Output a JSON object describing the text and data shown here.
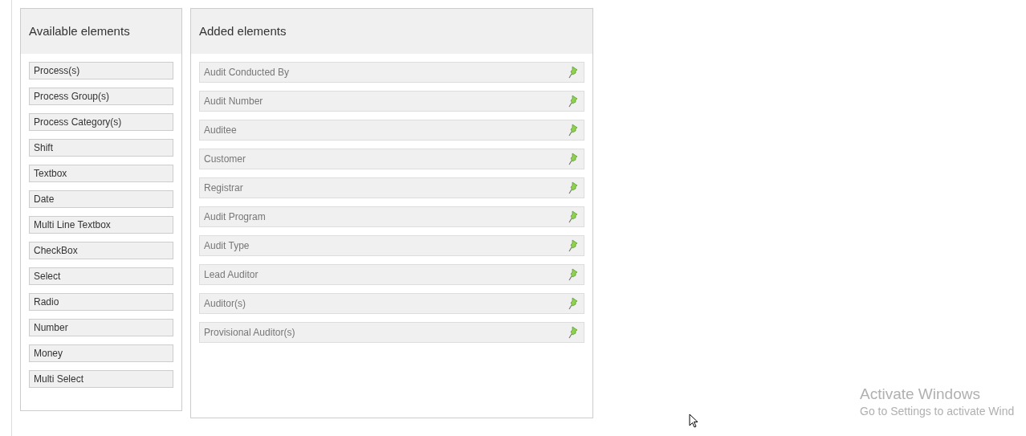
{
  "available_panel": {
    "title": "Available elements",
    "items": [
      {
        "label": "Process(s)"
      },
      {
        "label": "Process Group(s)"
      },
      {
        "label": "Process Category(s)"
      },
      {
        "label": "Shift"
      },
      {
        "label": "Textbox"
      },
      {
        "label": "Date"
      },
      {
        "label": "Multi Line Textbox"
      },
      {
        "label": "CheckBox"
      },
      {
        "label": "Select"
      },
      {
        "label": "Radio"
      },
      {
        "label": "Number"
      },
      {
        "label": "Money"
      },
      {
        "label": "Multi Select"
      }
    ]
  },
  "added_panel": {
    "title": "Added elements",
    "items": [
      {
        "label": "Audit Conducted By",
        "pinned": true
      },
      {
        "label": "Audit Number",
        "pinned": true
      },
      {
        "label": "Auditee",
        "pinned": true
      },
      {
        "label": "Customer",
        "pinned": true
      },
      {
        "label": "Registrar",
        "pinned": true
      },
      {
        "label": "Audit Program",
        "pinned": true
      },
      {
        "label": "Audit Type",
        "pinned": true
      },
      {
        "label": "Lead Auditor",
        "pinned": true
      },
      {
        "label": "Auditor(s)",
        "pinned": true
      },
      {
        "label": "Provisional Auditor(s)",
        "pinned": true
      }
    ]
  },
  "activation_notice": {
    "title": "Activate Windows",
    "message": "Go to Settings to activate Wind"
  }
}
